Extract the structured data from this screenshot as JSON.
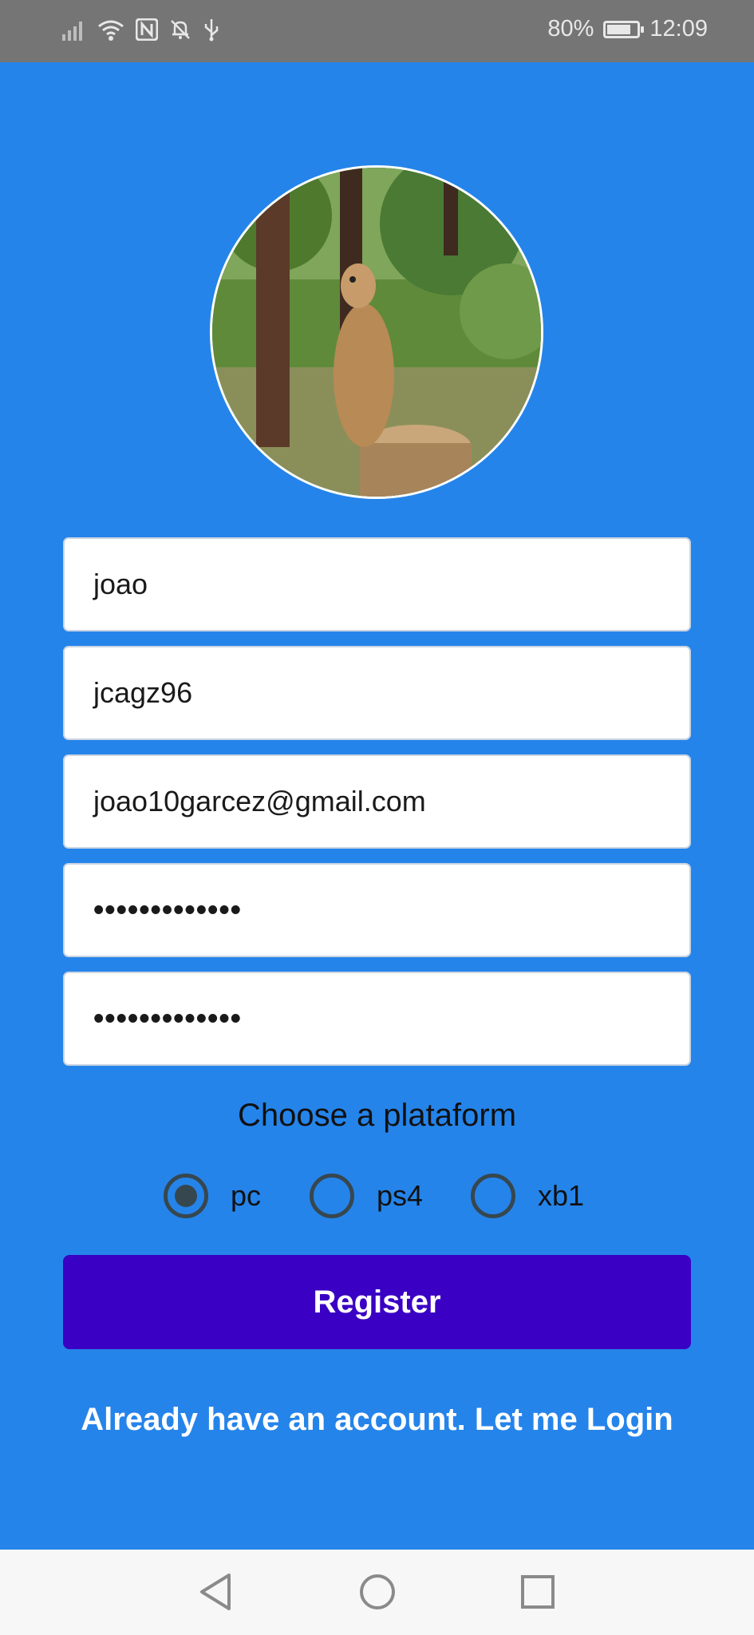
{
  "status_bar": {
    "battery": "80%",
    "battery_level": 0.8,
    "time": "12:09"
  },
  "form": {
    "name": "joao",
    "username": "jcagz96",
    "email": "joao10garcez@gmail.com",
    "password": "•••••••••••••",
    "confirm_password": "•••••••••••••"
  },
  "platform": {
    "label": "Choose a plataform",
    "options": [
      "pc",
      "ps4",
      "xb1"
    ],
    "selected": "pc"
  },
  "register_label": "Register",
  "login_link": "Already have an account. Let me Login",
  "colors": {
    "background": "#2584ea",
    "button": "#3a00c4",
    "status_bar": "#757575"
  },
  "icons": [
    "signal-icon",
    "wifi-icon",
    "nfc-icon",
    "bell-off-icon",
    "usb-icon",
    "battery-icon",
    "back-icon",
    "home-icon",
    "recents-icon"
  ]
}
